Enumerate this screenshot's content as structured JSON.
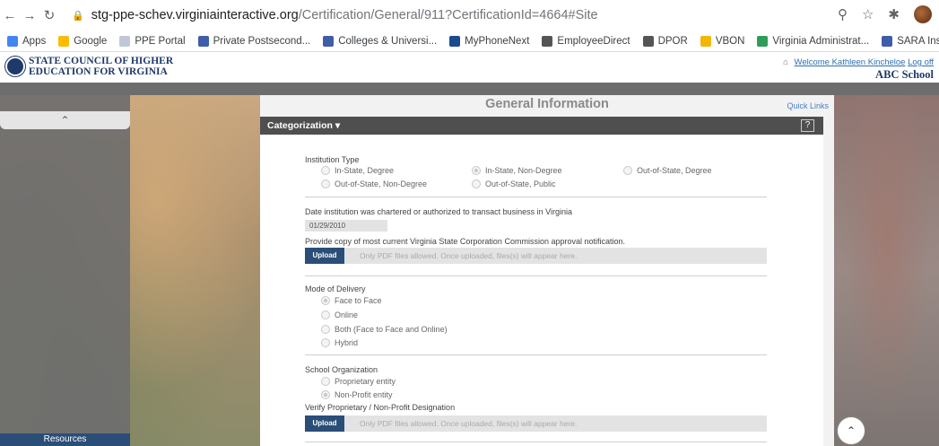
{
  "browser": {
    "url_host": "stg-ppe-schev.virginiainteractive.org",
    "url_path": "/Certification/General/911?CertificationId=4664#Site",
    "bookmarks": [
      {
        "label": "Apps",
        "color": "#4285f4"
      },
      {
        "label": "Google",
        "color": "#fbbc05"
      },
      {
        "label": "PPE Portal",
        "color": "#c0c8d8"
      },
      {
        "label": "Private Postsecond...",
        "color": "#3f5da8"
      },
      {
        "label": "Colleges & Universi...",
        "color": "#3f5da8"
      },
      {
        "label": "MyPhoneNext",
        "color": "#1c4a8f"
      },
      {
        "label": "EmployeeDirect",
        "color": "#555555"
      },
      {
        "label": "DPOR",
        "color": "#555555"
      },
      {
        "label": "VBON",
        "color": "#f2b705"
      },
      {
        "label": "Virginia Administrat...",
        "color": "#2e9d57"
      },
      {
        "label": "SARA Institutions",
        "color": "#3f5da8"
      }
    ]
  },
  "header": {
    "logo_line1": "STATE COUNCIL OF HIGHER",
    "logo_line2": "EDUCATION FOR VIRGINIA",
    "welcome": "Welcome Kathleen Kincheloe",
    "logoff": "Log off",
    "school": "ABC School"
  },
  "sidebar": {
    "resources": "Resources"
  },
  "main": {
    "title": "General Information",
    "quick_links": "Quick Links",
    "section_title": "Categorization ▾",
    "help": "?",
    "institution_type": {
      "label": "Institution Type",
      "options": [
        "In-State, Degree",
        "In-State, Non-Degree",
        "Out-of-State, Degree",
        "Out-of-State, Non-Degree",
        "Out-of-State, Public"
      ],
      "selected": "In-State, Non-Degree"
    },
    "chartered_label": "Date institution was chartered or authorized to transact business in Virginia",
    "chartered_date": "01/29/2010",
    "scc_label": "Provide copy of most current Virginia State Corporation Commission approval notification.",
    "upload_label": "Upload",
    "upload_hint": "Only PDF files allowed. Once uploaded, files(s) will appear here.",
    "delivery": {
      "label": "Mode of Delivery",
      "options": [
        "Face to Face",
        "Online",
        "Both (Face to Face and Online)",
        "Hybrid"
      ],
      "selected": "Face to Face"
    },
    "organization": {
      "label": "School Organization",
      "options": [
        "Proprietary entity",
        "Non-Profit entity"
      ],
      "selected": "Non-Profit entity"
    },
    "verify_label": "Verify Proprietary / Non-Profit Designation"
  }
}
